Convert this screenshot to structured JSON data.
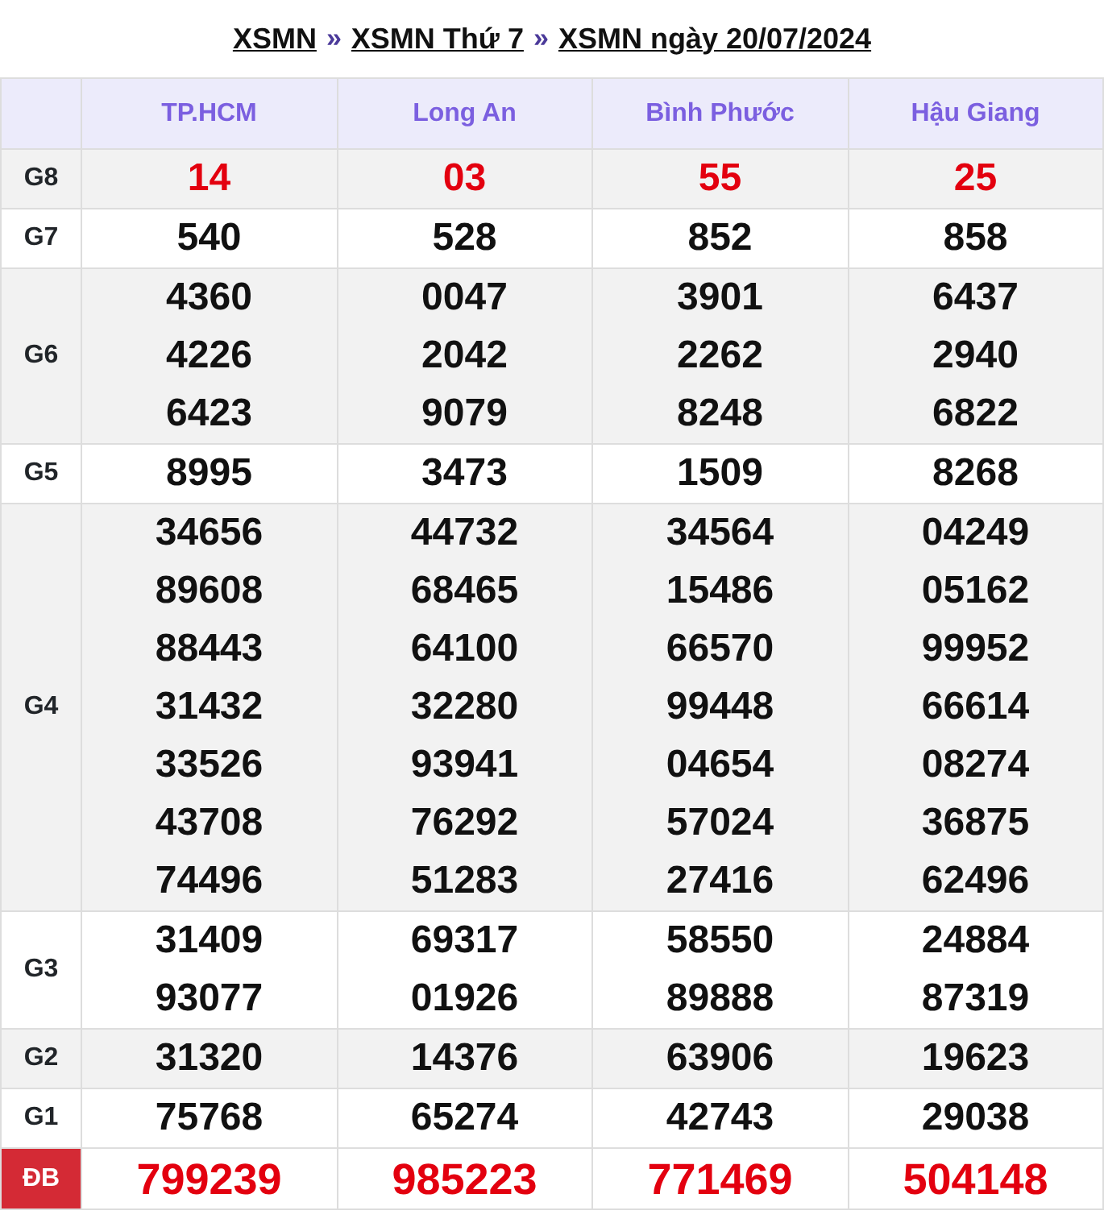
{
  "breadcrumb": [
    {
      "kind": "link",
      "text": "XSMN"
    },
    {
      "kind": "separator",
      "text": "»"
    },
    {
      "kind": "link",
      "text": "XSMN Thứ 7"
    },
    {
      "kind": "separator",
      "text": "»"
    },
    {
      "kind": "link",
      "text": "XSMN ngày 20/07/2024"
    }
  ],
  "table": {
    "columns": [
      "TP.HCM",
      "Long An",
      "Bình Phước",
      "Hậu Giang"
    ],
    "rows": [
      {
        "prize": "G8",
        "kind": "highlight",
        "cells": [
          [
            "14"
          ],
          [
            "03"
          ],
          [
            "55"
          ],
          [
            "25"
          ]
        ]
      },
      {
        "prize": "G7",
        "kind": "normal",
        "cells": [
          [
            "540"
          ],
          [
            "528"
          ],
          [
            "852"
          ],
          [
            "858"
          ]
        ]
      },
      {
        "prize": "G6",
        "kind": "normal",
        "cells": [
          [
            "4360",
            "4226",
            "6423"
          ],
          [
            "0047",
            "2042",
            "9079"
          ],
          [
            "3901",
            "2262",
            "8248"
          ],
          [
            "6437",
            "2940",
            "6822"
          ]
        ]
      },
      {
        "prize": "G5",
        "kind": "normal",
        "cells": [
          [
            "8995"
          ],
          [
            "3473"
          ],
          [
            "1509"
          ],
          [
            "8268"
          ]
        ]
      },
      {
        "prize": "G4",
        "kind": "normal",
        "cells": [
          [
            "34656",
            "89608",
            "88443",
            "31432",
            "33526",
            "43708",
            "74496"
          ],
          [
            "44732",
            "68465",
            "64100",
            "32280",
            "93941",
            "76292",
            "51283"
          ],
          [
            "34564",
            "15486",
            "66570",
            "99448",
            "04654",
            "57024",
            "27416"
          ],
          [
            "04249",
            "05162",
            "99952",
            "66614",
            "08274",
            "36875",
            "62496"
          ]
        ]
      },
      {
        "prize": "G3",
        "kind": "normal",
        "cells": [
          [
            "31409",
            "93077"
          ],
          [
            "69317",
            "01926"
          ],
          [
            "58550",
            "89888"
          ],
          [
            "24884",
            "87319"
          ]
        ]
      },
      {
        "prize": "G2",
        "kind": "normal",
        "cells": [
          [
            "31320"
          ],
          [
            "14376"
          ],
          [
            "63906"
          ],
          [
            "19623"
          ]
        ]
      },
      {
        "prize": "G1",
        "kind": "normal",
        "cells": [
          [
            "75768"
          ],
          [
            "65274"
          ],
          [
            "42743"
          ],
          [
            "29038"
          ]
        ]
      },
      {
        "prize": "ĐB",
        "kind": "special",
        "cells": [
          [
            "799239"
          ],
          [
            "985223"
          ],
          [
            "771469"
          ],
          [
            "504148"
          ]
        ]
      }
    ]
  }
}
